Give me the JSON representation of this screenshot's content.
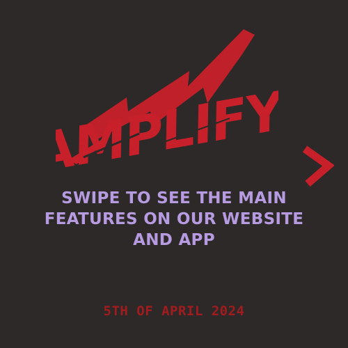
{
  "logo": {
    "text": "AMPLIFY",
    "color": "#c8202a"
  },
  "headline": {
    "text": "SWIPE TO SEE THE MAIN FEATURES ON OUR WEBSITE AND APP",
    "color": "#b79be0"
  },
  "date": {
    "text": "5TH OF APRIL 2024",
    "color": "#a11c1e"
  },
  "nav": {
    "icon": "chevron-right-icon"
  },
  "colors": {
    "background": "#2c2928"
  }
}
